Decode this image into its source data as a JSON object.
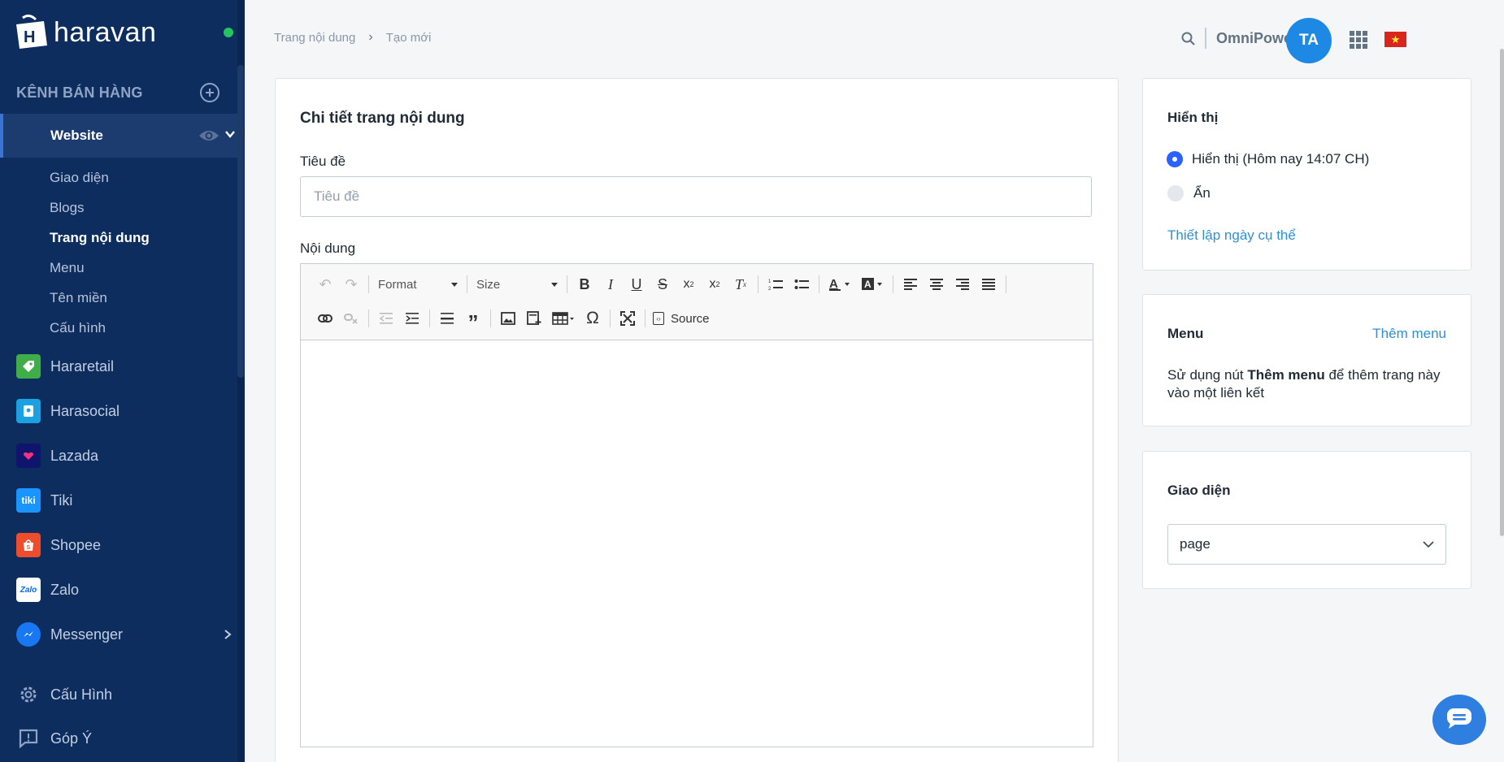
{
  "sidebar": {
    "brand": "haravan",
    "channels_header": "KÊNH BÁN HÀNG",
    "website": {
      "label": "Website",
      "subitems": [
        "Giao diện",
        "Blogs",
        "Trang nội dung",
        "Menu",
        "Tên miền",
        "Cấu hình"
      ],
      "active_index": 2
    },
    "channels": [
      {
        "name": "Hararetail",
        "icon": "hararetail-icon",
        "color": "#3fae49"
      },
      {
        "name": "Harasocial",
        "icon": "harasocial-icon",
        "color": "#1ba0e2"
      },
      {
        "name": "Lazada",
        "icon": "lazada-icon",
        "color": "#0f146d"
      },
      {
        "name": "Tiki",
        "icon": "tiki-icon",
        "color": "#1a94ff"
      },
      {
        "name": "Shopee",
        "icon": "shopee-icon",
        "color": "#ee4d2d"
      },
      {
        "name": "Zalo",
        "icon": "zalo-icon",
        "color": "#0068ff"
      },
      {
        "name": "Messenger",
        "icon": "messenger-icon",
        "color": "#1877f2"
      }
    ],
    "bottom": [
      {
        "name": "Cấu Hình",
        "icon": "gear-icon"
      },
      {
        "name": "Góp Ý",
        "icon": "feedback-icon"
      }
    ],
    "online_color": "#22c55e"
  },
  "header": {
    "breadcrumb": [
      "Trang nội dung",
      "Tạo mới"
    ],
    "user_name": "OmniPower",
    "avatar_initials": "TA"
  },
  "main": {
    "title": "Chi tiết trang nội dung",
    "title_label": "Tiêu đề",
    "title_placeholder": "Tiêu đề",
    "content_label": "Nội dung",
    "editor": {
      "format_label": "Format",
      "size_label": "Size",
      "source_label": "Source"
    }
  },
  "visibility": {
    "title": "Hiển thị",
    "options": [
      "Hiển thị (Hôm nay 14:07 CH)",
      "Ẩn"
    ],
    "selected": 0,
    "schedule_link": "Thiết lập ngày cụ thể"
  },
  "menu_card": {
    "title": "Menu",
    "add_link": "Thêm menu",
    "desc_before": "Sử dụng nút ",
    "desc_bold": "Thêm menu",
    "desc_after": " để thêm trang này vào một liên kết"
  },
  "theme_card": {
    "title": "Giao diện",
    "selected": "page"
  },
  "colors": {
    "sidebar_bg": "#0d2d5e",
    "accent": "#2962ff",
    "link": "#2d8fd8",
    "avatar": "#1e88e5"
  }
}
